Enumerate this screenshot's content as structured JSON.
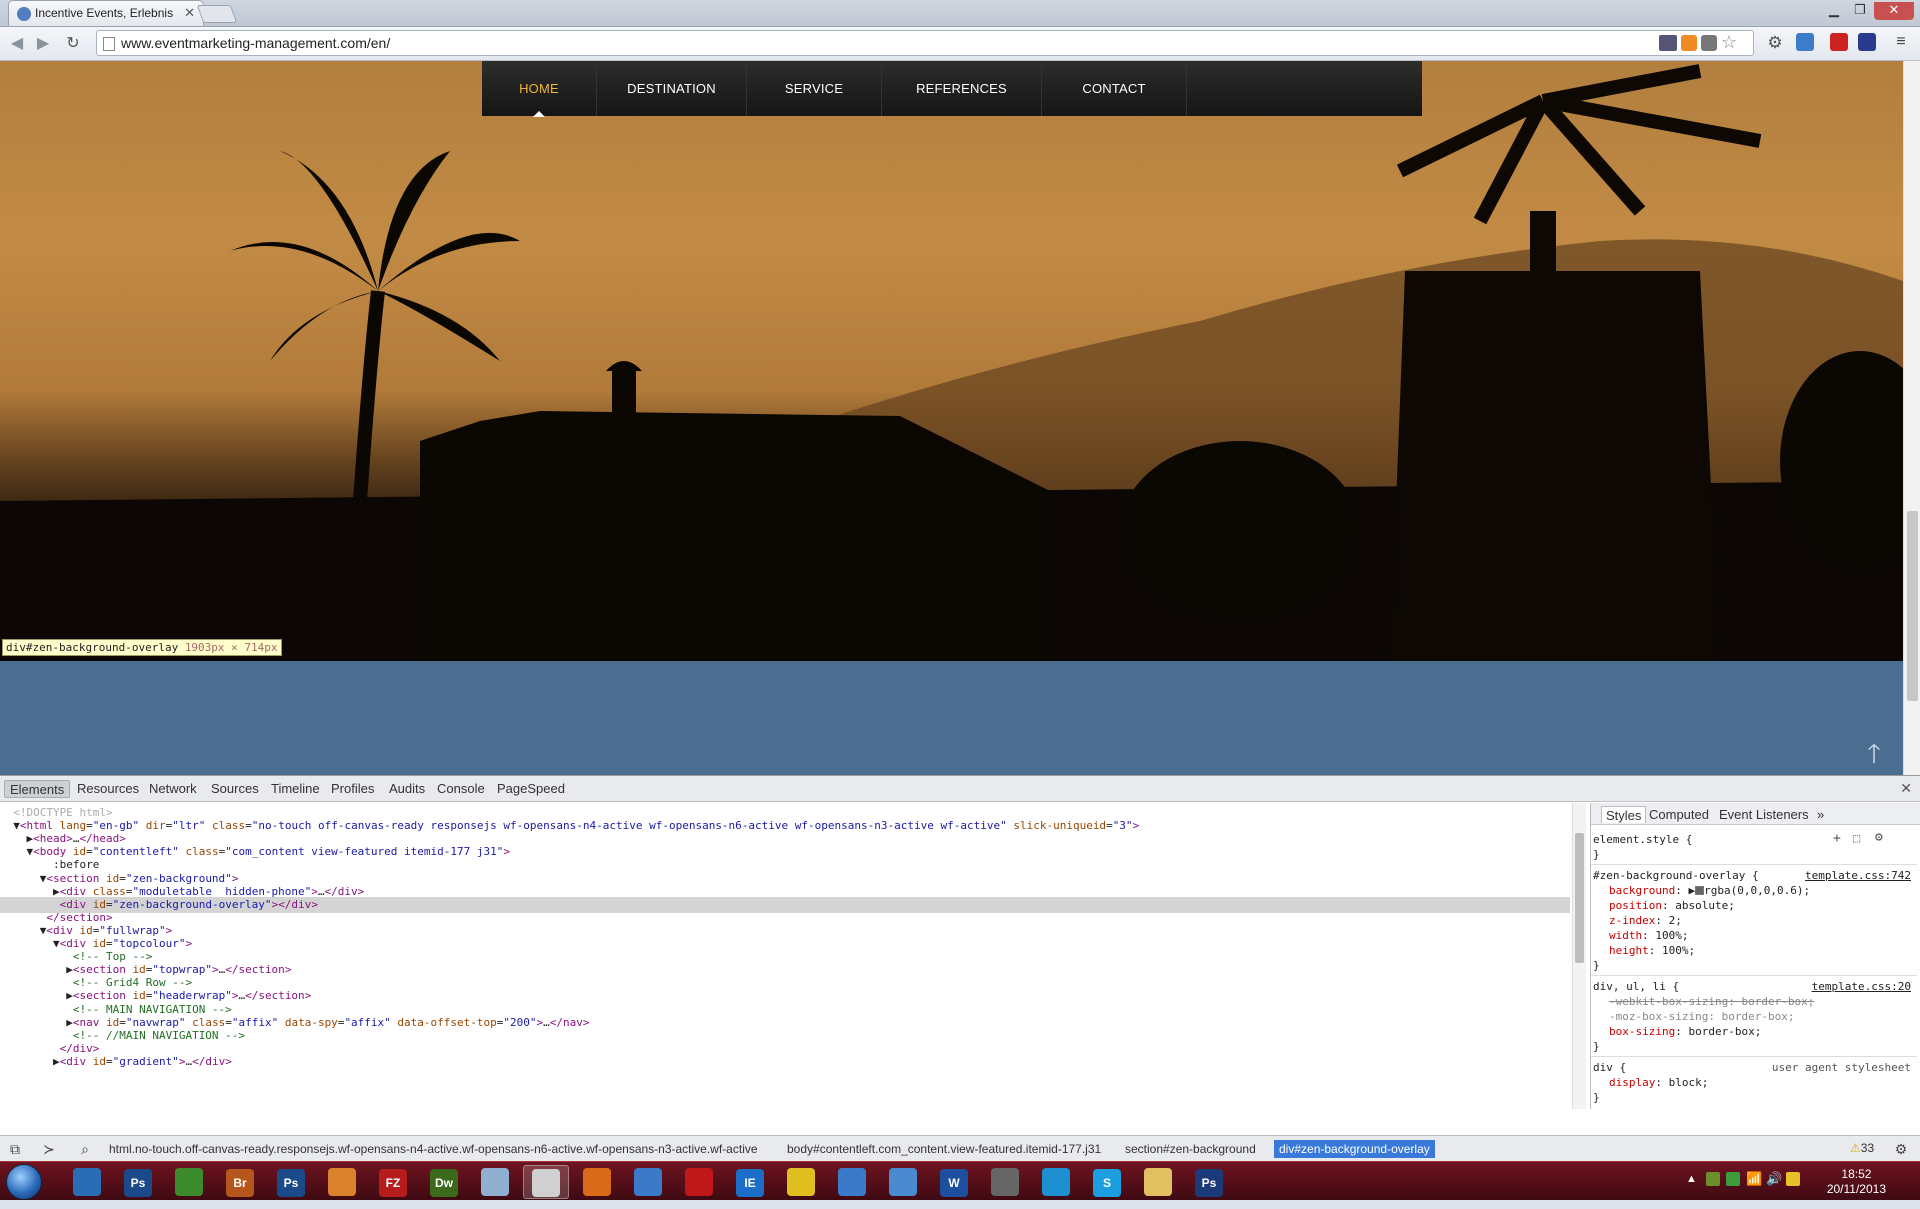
{
  "browser": {
    "tab_title": "Incentive Events, Erlebnis",
    "url": "www.eventmarketing-management.com/en/"
  },
  "site_nav": {
    "items": [
      {
        "label": "HOME",
        "active": true
      },
      {
        "label": "DESTINATION",
        "active": false
      },
      {
        "label": "SERVICE",
        "active": false
      },
      {
        "label": "REFERENCES",
        "active": false
      },
      {
        "label": "CONTACT",
        "active": false
      }
    ],
    "accent_color": "#f0b63a"
  },
  "inspect_tooltip": {
    "selector": "div#zen-background-overlay",
    "size": "1903px × 714px"
  },
  "devtools": {
    "tabs": [
      "Elements",
      "Resources",
      "Network",
      "Sources",
      "Timeline",
      "Profiles",
      "Audits",
      "Console",
      "PageSpeed"
    ],
    "active_tab": "Elements",
    "dom_lines": [
      "<!DOCTYPE html>",
      "▼<html lang=\"en-gb\" dir=\"ltr\" class=\"no-touch off-canvas-ready responsejs wf-opensans-n4-active wf-opensans-n6-active wf-opensans-n3-active wf-active\" slick-uniqueid=\"3\">",
      "  ▶<head>…</head>",
      "  ▼<body id=\"contentleft\" class=\"com_content view-featured itemid-177 j31\">",
      "      :before",
      "    ▼<section id=\"zen-background\">",
      "      ▶<div class=\"moduletable  hidden-phone\">…</div>",
      "       <div id=\"zen-background-overlay\"></div>",
      "     </section>",
      "    ▼<div id=\"fullwrap\">",
      "      ▼<div id=\"topcolour\">",
      "         <!-- Top -->",
      "        ▶<section id=\"topwrap\">…</section>",
      "         <!-- Grid4 Row -->",
      "        ▶<section id=\"headerwrap\">…</section>",
      "         <!-- MAIN NAVIGATION -->",
      "        ▶<nav id=\"navwrap\" class=\"affix\" data-spy=\"affix\" data-offset-top=\"200\">…</nav>",
      "         <!-- //MAIN NAVIGATION -->",
      "       </div>",
      "      ▶<div id=\"gradient\">…</div>"
    ],
    "selected_line": 7,
    "side_tabs": [
      "Styles",
      "Computed",
      "Event Listeners",
      "»"
    ],
    "styles": {
      "element_style": "element.style {",
      "rule1_selector": "#zen-background-overlay {",
      "rule1_source": "template.css:742",
      "rule1_props": [
        {
          "name": "background",
          "value": "rgba(0,0,0,0.6);"
        },
        {
          "name": "position",
          "value": "absolute;"
        },
        {
          "name": "z-index",
          "value": "2;"
        },
        {
          "name": "width",
          "value": "100%;"
        },
        {
          "name": "height",
          "value": "100%;"
        }
      ],
      "rule2_selector": "div, ul, li {",
      "rule2_source": "template.css:20",
      "rule2_props": [
        {
          "name": "-webkit-box-sizing",
          "value": "border-box;",
          "struck": true
        },
        {
          "name": "-moz-box-sizing",
          "value": "border-box;",
          "struck": false
        },
        {
          "name": "box-sizing",
          "value": "border-box;",
          "struck": false
        }
      ],
      "rule3_selector": "div {",
      "rule3_source": "user agent stylesheet",
      "rule3_props": [
        {
          "name": "display",
          "value": "block;"
        }
      ],
      "close_brace": "}"
    },
    "breadcrumbs": [
      "html.no-touch.off-canvas-ready.responsejs.wf-opensans-n4-active.wf-opensans-n6-active.wf-opensans-n3-active.wf-active",
      "body#contentleft.com_content.view-featured.itemid-177.j31",
      "section#zen-background",
      "div#zen-background-overlay"
    ],
    "warning_count": "33"
  },
  "taskbar": {
    "apps": [
      "Outlook",
      "Ps",
      "Torrent",
      "Br",
      "Ps",
      "Files",
      "FZ",
      "Dw",
      "Notes",
      "Chrome",
      "Firefox",
      "Safari",
      "Opera",
      "IE",
      "Tool",
      "Mail",
      "Net",
      "W",
      "Cam",
      "Chat",
      "S",
      "Explorer",
      "Ps"
    ],
    "time": "18:52",
    "date": "20/11/2013"
  }
}
